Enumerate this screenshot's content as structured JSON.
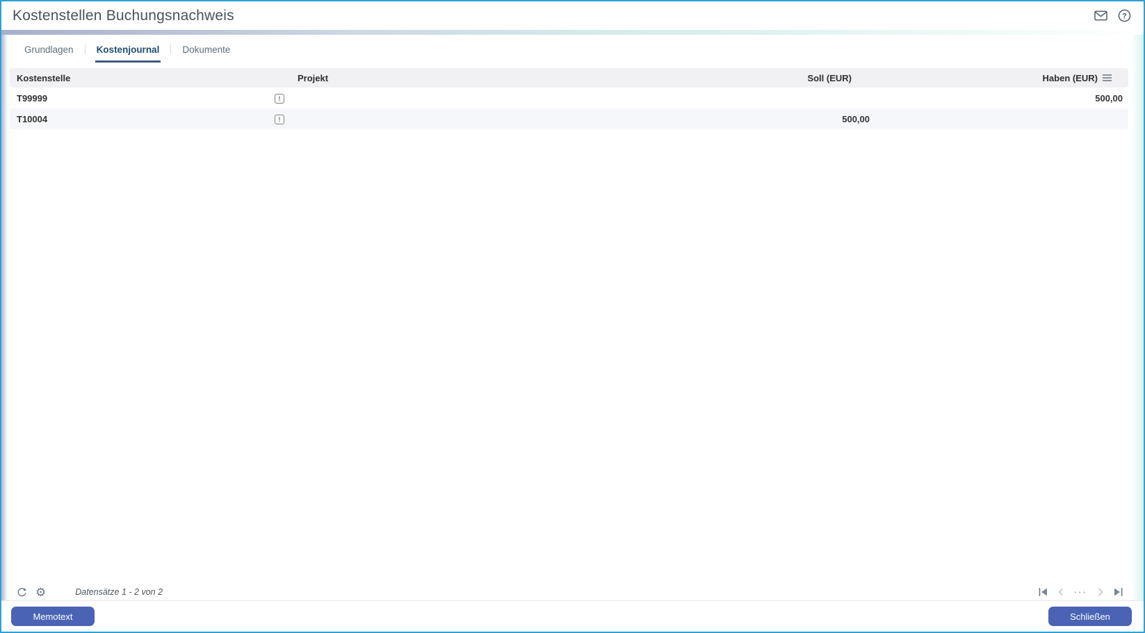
{
  "window": {
    "title": "Kostenstellen Buchungsnachweis"
  },
  "tabs": [
    {
      "label": "Grundlagen",
      "active": false
    },
    {
      "label": "Kostenjournal",
      "active": true
    },
    {
      "label": "Dokumente",
      "active": false
    }
  ],
  "table": {
    "columns": [
      {
        "label": "Kostenstelle",
        "align": "left"
      },
      {
        "label": "Projekt",
        "align": "left"
      },
      {
        "label": "Soll (EUR)",
        "align": "right"
      },
      {
        "label": "Haben (EUR)",
        "align": "right",
        "menu_icon": "hamburger-icon"
      }
    ],
    "rows": [
      {
        "kostenstelle": "T99999",
        "projekt_note_icon": "!",
        "soll": "",
        "haben": "500,00"
      },
      {
        "kostenstelle": "T10004",
        "projekt_note_icon": "!",
        "soll": "500,00",
        "haben": ""
      }
    ]
  },
  "footer": {
    "records_text": "Datensätze 1 - 2 von 2",
    "left_icons": [
      "refresh-icon",
      "settings-gear-icon"
    ],
    "pagination_icons": [
      "first-page-icon",
      "previous-page-icon",
      "ellipsis-icon",
      "next-page-icon",
      "last-page-icon"
    ]
  },
  "titlebar_icons": [
    "mail-icon",
    "help-icon"
  ],
  "buttons": {
    "memotext": "Memotext",
    "schliessen": "Schließen"
  },
  "colors": {
    "window_border": "#2ba0d8",
    "button": "#4a63b4",
    "active_tab_text": "#1d4e74",
    "tab_underline": "#3e5c7b",
    "header_bg": "#f1f1f4",
    "alt_row_bg": "#f6f7fa"
  }
}
